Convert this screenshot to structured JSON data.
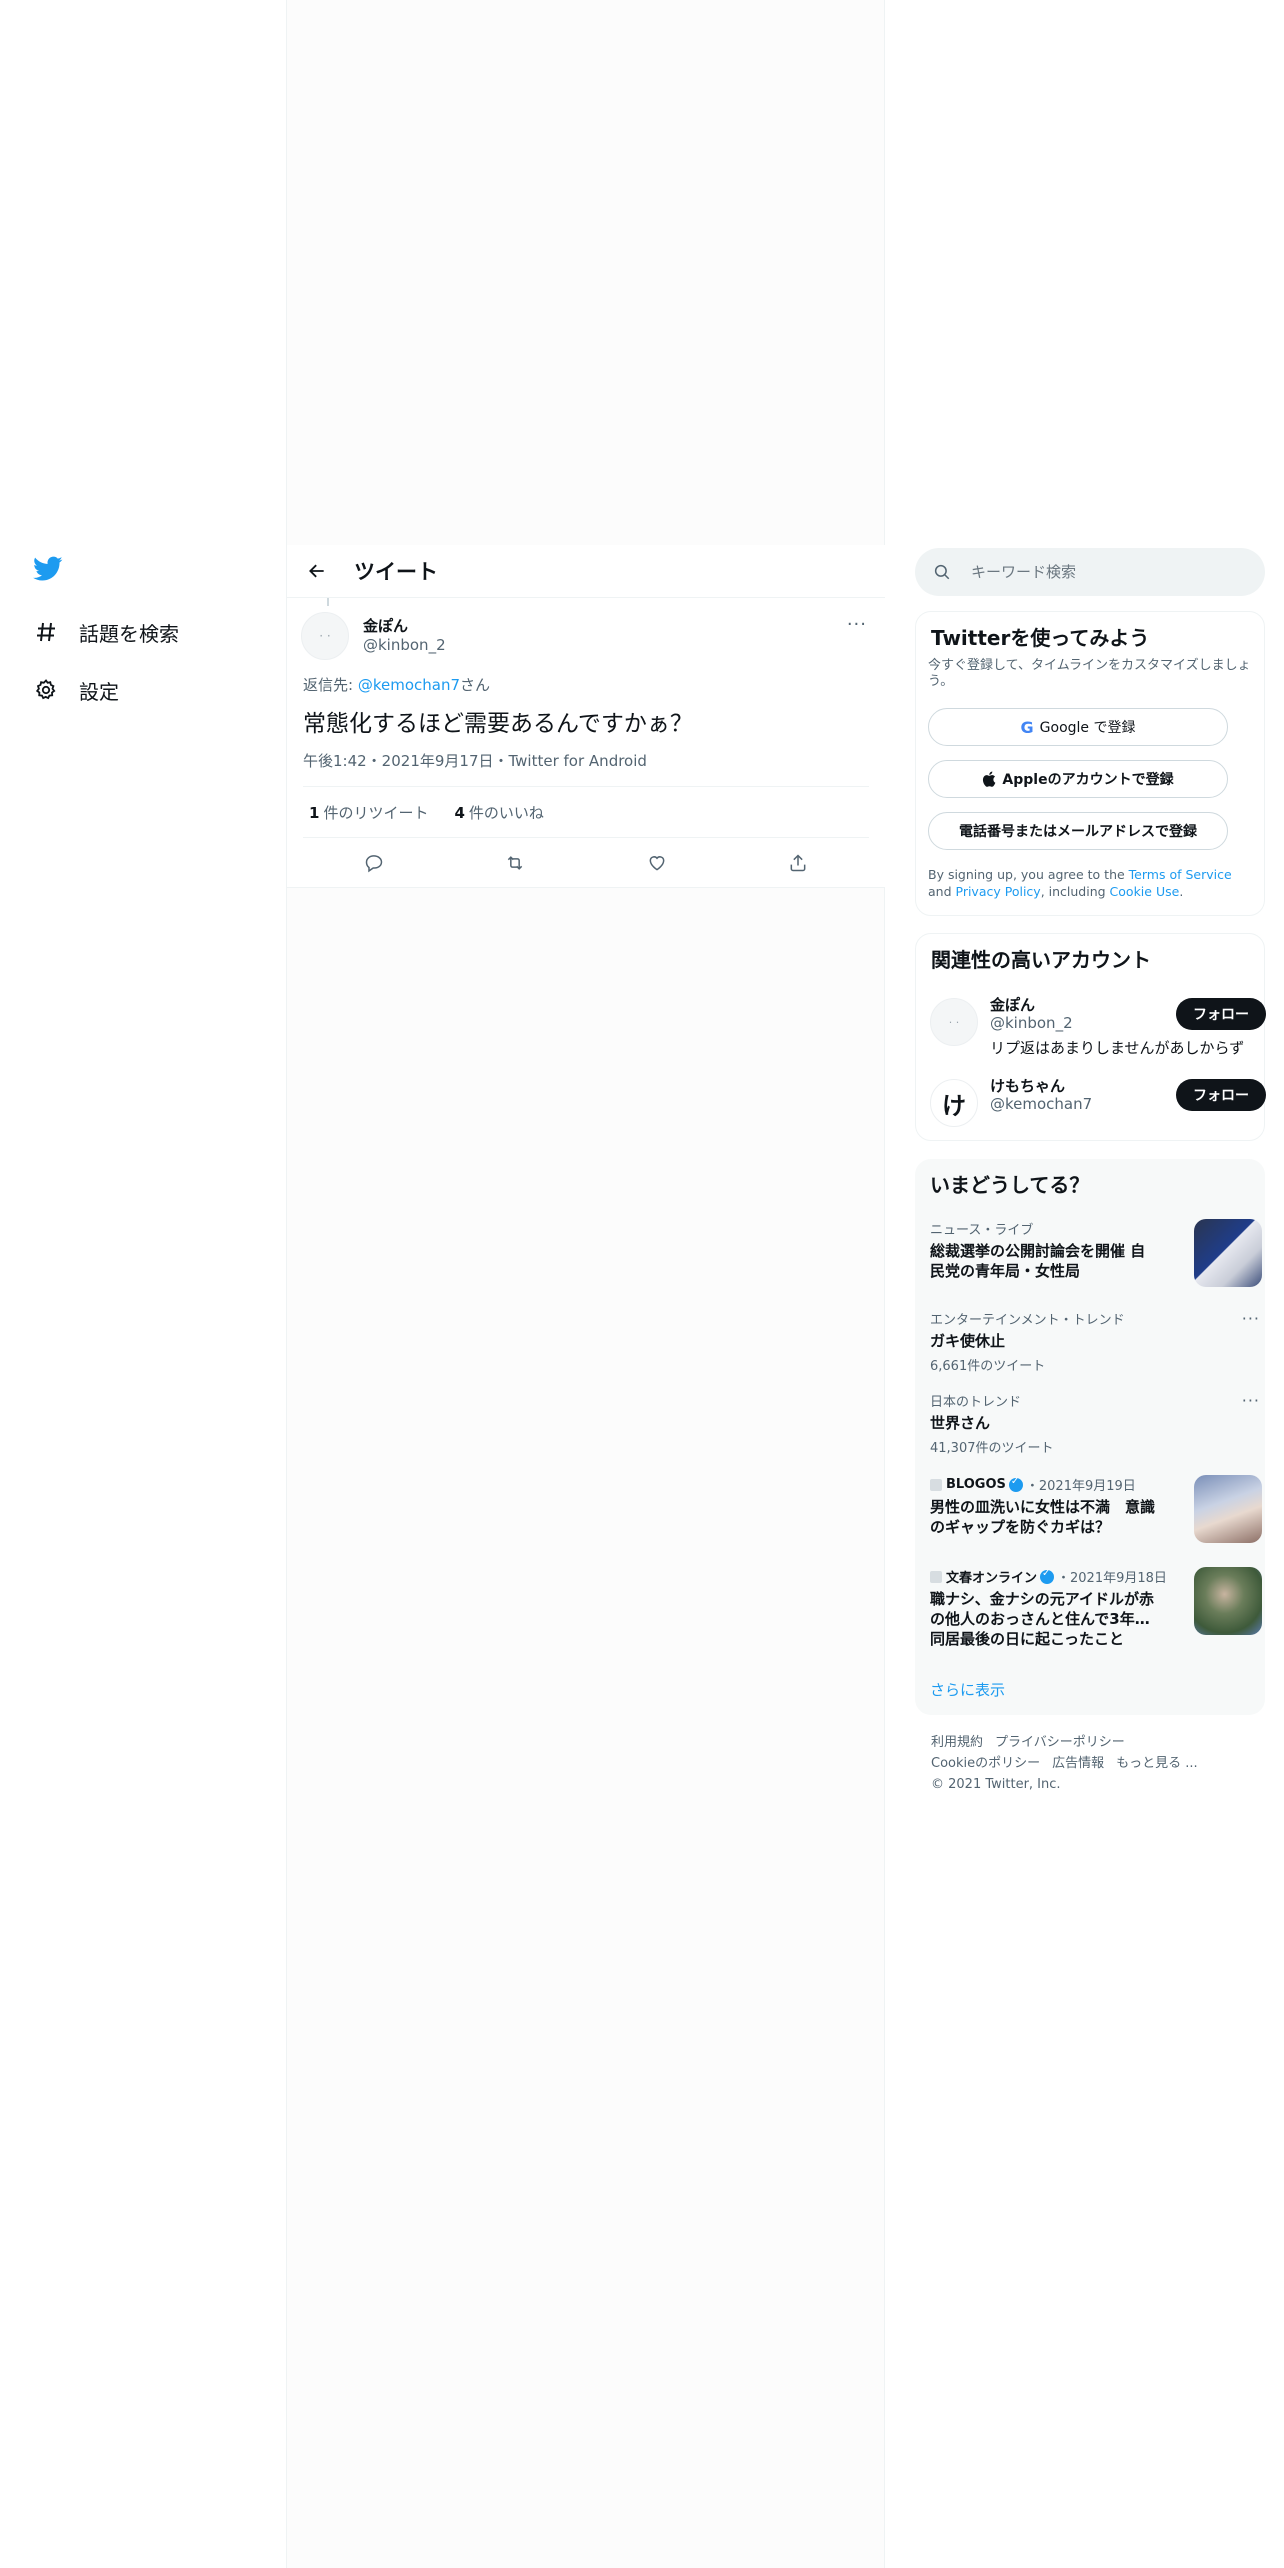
{
  "nav": {
    "explore_label": "話題を検索",
    "settings_label": "設定"
  },
  "header": {
    "title": "ツイート"
  },
  "tweet": {
    "author_name": "金ぽん",
    "author_handle": "@kinbon_2",
    "reply_prefix": "返信先: ",
    "reply_mention": "@kemochan7",
    "reply_suffix": "さん",
    "text": "常態化するほど需要あるんですかぁ？",
    "meta": "午後1:42・2021年9月17日・Twitter for Android",
    "retweet_count": "1",
    "retweet_label": "件のリツイート",
    "like_count": "4",
    "like_label": "件のいいね"
  },
  "search": {
    "placeholder": "キーワード検索"
  },
  "signup": {
    "title": "Twitterを使ってみよう",
    "subtitle": "今すぐ登録して、タイムラインをカスタマイズしましょう。",
    "google_label": "Google で登録",
    "apple_label": "Appleのアカウントで登録",
    "phone_label": "電話番号またはメールアドレスで登録",
    "legal_1": "By signing up, you agree to the ",
    "legal_terms": "Terms of Service",
    "legal_2": " and ",
    "legal_privacy": "Privacy Policy",
    "legal_3": ", including ",
    "legal_cookie": "Cookie Use",
    "legal_4": "."
  },
  "related": {
    "title": "関連性の高いアカウント",
    "follow_label": "フォロー",
    "accounts": [
      {
        "name": "金ぽん",
        "handle": "@kinbon_2",
        "bio": "リプ返はあまりしませんがあしからず"
      },
      {
        "name": "けもちゃん",
        "handle": "@kemochan7",
        "avatar_char": "け"
      }
    ]
  },
  "trends": {
    "title": "いまどうしてる？",
    "items": [
      {
        "context": "ニュース・ライブ",
        "title": "総裁選挙の公開討論会を開催 自民党の青年局・女性局"
      },
      {
        "context": "エンターテインメント・トレンド",
        "title": "ガキ使休止",
        "count": "6,661件のツイート"
      },
      {
        "context": "日本のトレンド",
        "title": "世界さん",
        "count": "41,307件のツイート"
      },
      {
        "source": "BLOGOS",
        "date": "・2021年9月19日",
        "title": "男性の皿洗いに女性は不満　意識のギャップを防ぐカギは？"
      },
      {
        "source": "文春オンライン",
        "date": "・2021年9月18日",
        "title": "職ナシ、金ナシの元アイドルが赤の他人のおっさんと住んで3年…同居最後の日に起こったこと"
      }
    ],
    "show_more": "さらに表示"
  },
  "footer": {
    "terms": "利用規約",
    "privacy": "プライバシーポリシー",
    "cookie": "Cookieのポリシー",
    "ads": "広告情報",
    "more": "もっと見る ...",
    "copyright": "© 2021 Twitter, Inc."
  },
  "colors": {
    "accent": "#1d9bf0",
    "text": "#0f1419",
    "muted": "#536471",
    "panel": "#f7f9f9"
  }
}
